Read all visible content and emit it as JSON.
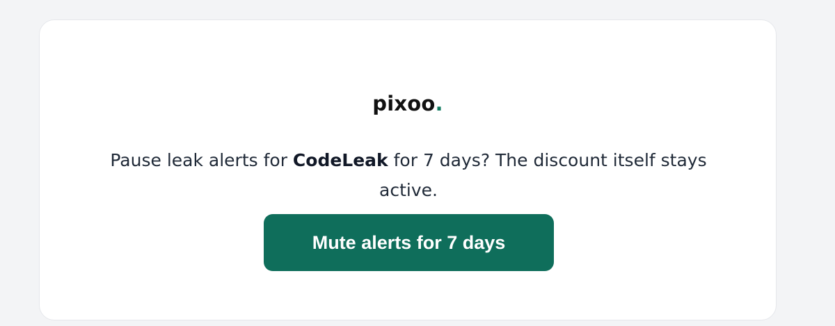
{
  "brand": {
    "name": "pixoo",
    "dot": ".",
    "accent_color": "#0f7a5f"
  },
  "message": {
    "before": "Pause leak alerts for ",
    "product": "CodeLeak",
    "after": " for 7 days? The discount itself stays active."
  },
  "actions": {
    "mute_label": "Mute alerts for 7 days",
    "button_color": "#0f6e5b"
  }
}
